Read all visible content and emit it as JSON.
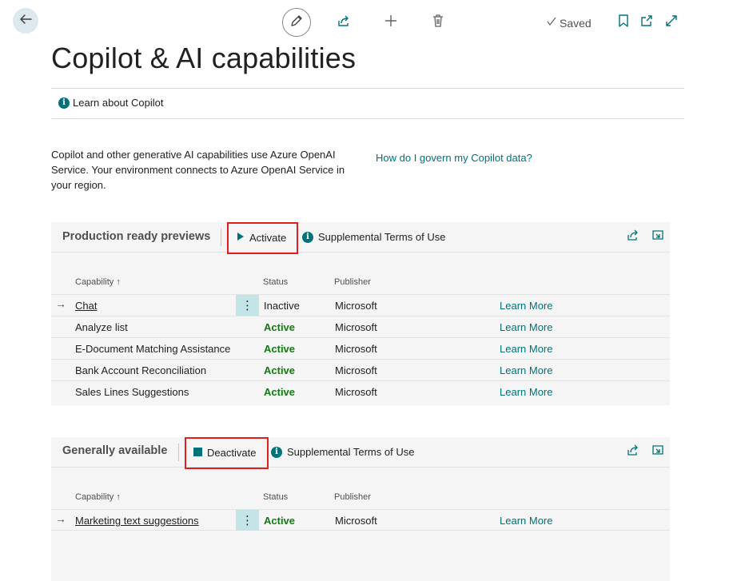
{
  "toolbar": {
    "back_icon": "arrow-left-icon",
    "edit_icon": "pencil-icon",
    "share_icon": "share-icon",
    "new_icon": "plus-icon",
    "delete_icon": "trash-icon",
    "saved_label": "Saved",
    "bookmark_icon": "bookmark-icon",
    "open_new_window_icon": "open-in-new-icon",
    "expand_icon": "expand-icon"
  },
  "page_title": "Copilot & AI capabilities",
  "learn_about": "Learn about Copilot",
  "description": "Copilot and other generative AI capabilities use Azure OpenAI Service. Your environment connects to Azure OpenAI Service in your region.",
  "govern_link": "How do I govern my Copilot data?",
  "colors": {
    "accent": "#00737a",
    "active_status": "#107c10",
    "highlight_box": "#e02020",
    "panel_bg": "#f5f5f5"
  },
  "columns": {
    "capability": "Capability ↑",
    "status": "Status",
    "publisher": "Publisher"
  },
  "previews": {
    "title": "Production ready previews",
    "action_label": "Activate",
    "terms_label": "Supplemental Terms of Use",
    "rows": [
      {
        "capability": "Chat",
        "status": "Inactive",
        "publisher": "Microsoft",
        "learn": "Learn More"
      },
      {
        "capability": "Analyze list",
        "status": "Active",
        "publisher": "Microsoft",
        "learn": "Learn More"
      },
      {
        "capability": "E-Document Matching Assistance",
        "status": "Active",
        "publisher": "Microsoft",
        "learn": "Learn More"
      },
      {
        "capability": "Bank Account Reconciliation",
        "status": "Active",
        "publisher": "Microsoft",
        "learn": "Learn More"
      },
      {
        "capability": "Sales Lines Suggestions",
        "status": "Active",
        "publisher": "Microsoft",
        "learn": "Learn More"
      }
    ]
  },
  "general": {
    "title": "Generally available",
    "action_label": "Deactivate",
    "terms_label": "Supplemental Terms of Use",
    "rows": [
      {
        "capability": "Marketing text suggestions",
        "status": "Active",
        "publisher": "Microsoft",
        "learn": "Learn More"
      }
    ]
  }
}
